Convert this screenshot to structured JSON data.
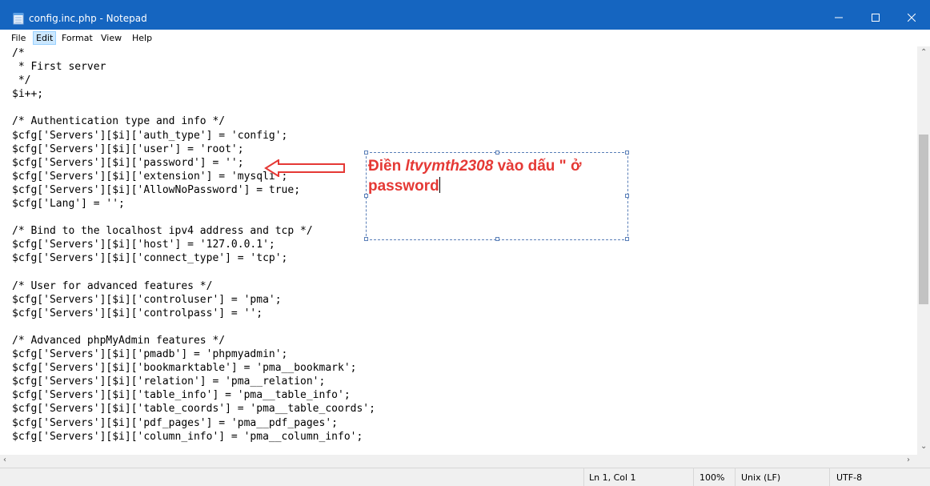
{
  "window": {
    "title": "config.inc.php - Notepad",
    "accent_color": "#1565c0",
    "controls": {
      "minimize": "minimize-icon",
      "maximize": "maximize-icon",
      "close": "close-icon"
    }
  },
  "menu": {
    "items": [
      "File",
      "Edit",
      "Format",
      "View",
      "Help"
    ],
    "active": "Edit"
  },
  "editor": {
    "lines": [
      "/*",
      " * First server",
      " */",
      "$i++;",
      "",
      "/* Authentication type and info */",
      "$cfg['Servers'][$i]['auth_type'] = 'config';",
      "$cfg['Servers'][$i]['user'] = 'root';",
      "$cfg['Servers'][$i]['password'] = '';",
      "$cfg['Servers'][$i]['extension'] = 'mysqli';",
      "$cfg['Servers'][$i]['AllowNoPassword'] = true;",
      "$cfg['Lang'] = '';",
      "",
      "/* Bind to the localhost ipv4 address and tcp */",
      "$cfg['Servers'][$i]['host'] = '127.0.0.1';",
      "$cfg['Servers'][$i]['connect_type'] = 'tcp';",
      "",
      "/* User for advanced features */",
      "$cfg['Servers'][$i]['controluser'] = 'pma';",
      "$cfg['Servers'][$i]['controlpass'] = '';",
      "",
      "/* Advanced phpMyAdmin features */",
      "$cfg['Servers'][$i]['pmadb'] = 'phpmyadmin';",
      "$cfg['Servers'][$i]['bookmarktable'] = 'pma__bookmark';",
      "$cfg['Servers'][$i]['relation'] = 'pma__relation';",
      "$cfg['Servers'][$i]['table_info'] = 'pma__table_info';",
      "$cfg['Servers'][$i]['table_coords'] = 'pma__table_coords';",
      "$cfg['Servers'][$i]['pdf_pages'] = 'pma__pdf_pages';",
      "$cfg['Servers'][$i]['column_info'] = 'pma__column_info';"
    ]
  },
  "annotation": {
    "text_prefix": "Điền ",
    "text_italic": "ltvymth2308",
    "text_suffix": " vào dấu \" ở password",
    "color": "#e53935"
  },
  "status": {
    "position": "Ln 1, Col 1",
    "zoom": "100%",
    "line_ending": "Unix (LF)",
    "encoding": "UTF-8"
  }
}
